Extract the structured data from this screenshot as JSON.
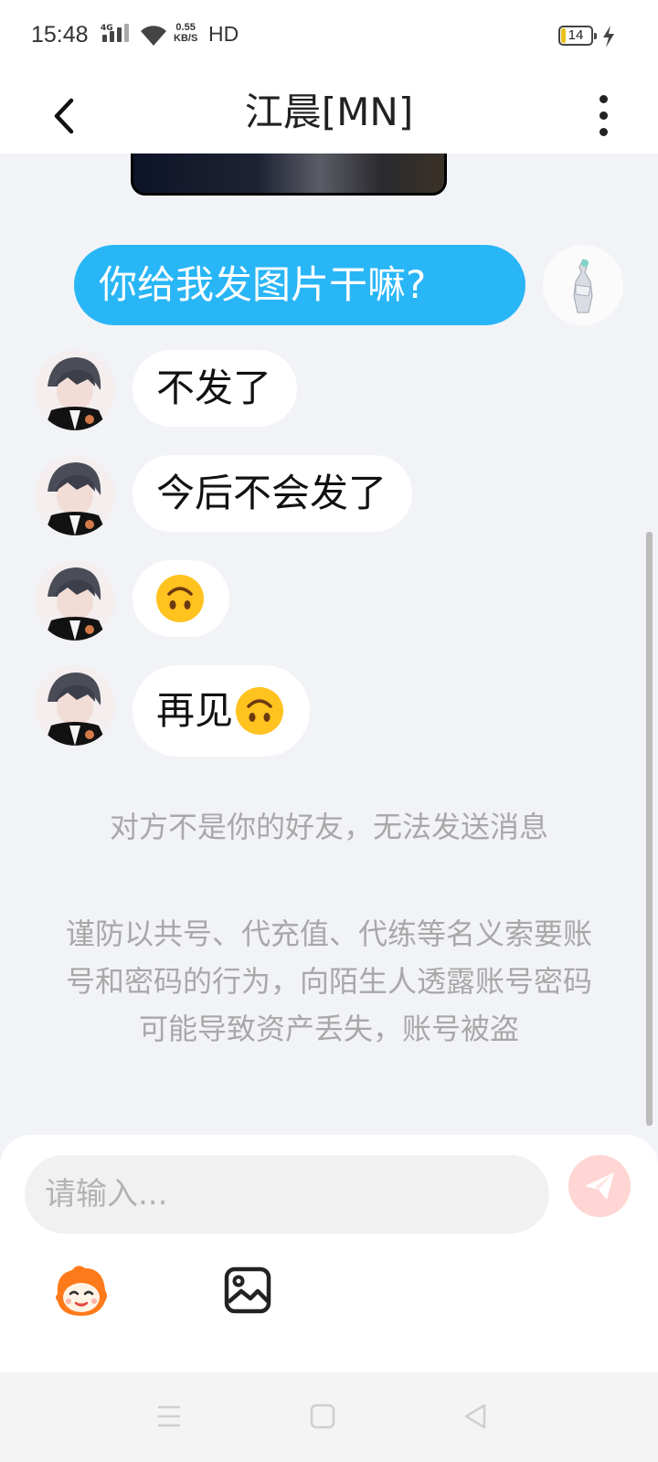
{
  "status_bar": {
    "time": "15:48",
    "network_label": "4G",
    "speed_value": "0.55",
    "speed_unit": "KB/S",
    "hd_label": "HD",
    "battery_level": "14"
  },
  "header": {
    "title": "江晨[MN]",
    "back_icon": "chevron-left-icon",
    "more_icon": "more-vertical-icon"
  },
  "messages": [
    {
      "from": "me",
      "text": "你给我发图片干嘛?"
    },
    {
      "from": "them",
      "text": "不发了"
    },
    {
      "from": "them",
      "text": "今后不会发了"
    },
    {
      "from": "them",
      "text": "",
      "emoji": "upside-down-face"
    },
    {
      "from": "them",
      "text": "再见",
      "emoji": "upside-down-face"
    }
  ],
  "notices": {
    "not_friend": "对方不是你的好友，无法发送消息",
    "security_warning": "谨防以共号、代充值、代练等名义索要账号和密码的行为，向陌生人透露账号密码可能导致资产丢失，账号被盗"
  },
  "composer": {
    "placeholder": "请输入...",
    "send_icon": "paper-plane-icon",
    "tools": [
      "sticker-icon",
      "image-icon"
    ]
  },
  "nav": [
    "menu-icon",
    "home-square-icon",
    "back-triangle-icon"
  ],
  "colors": {
    "accent": "#29b6f6",
    "background": "#f2f3f7",
    "send_button": "#ffd6d3",
    "notice_text": "#a8a8a8"
  }
}
